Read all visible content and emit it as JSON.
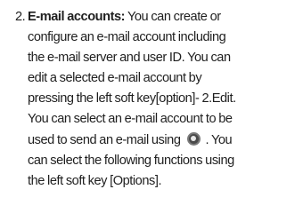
{
  "item": {
    "number": "2.",
    "heading": "E-mail accounts:",
    "lines": [
      "You can create or",
      "configure an e-mail account including",
      "the e-mail server and user ID. You can",
      "edit a selected e-mail account by",
      "pressing the left soft key[option]- 2.Edit.",
      "You can select an e-mail account to be",
      "used to send an e-mail using",
      ". You",
      "can select the following functions using",
      "the left soft key [Options]."
    ],
    "icon": "ok-key-icon"
  }
}
